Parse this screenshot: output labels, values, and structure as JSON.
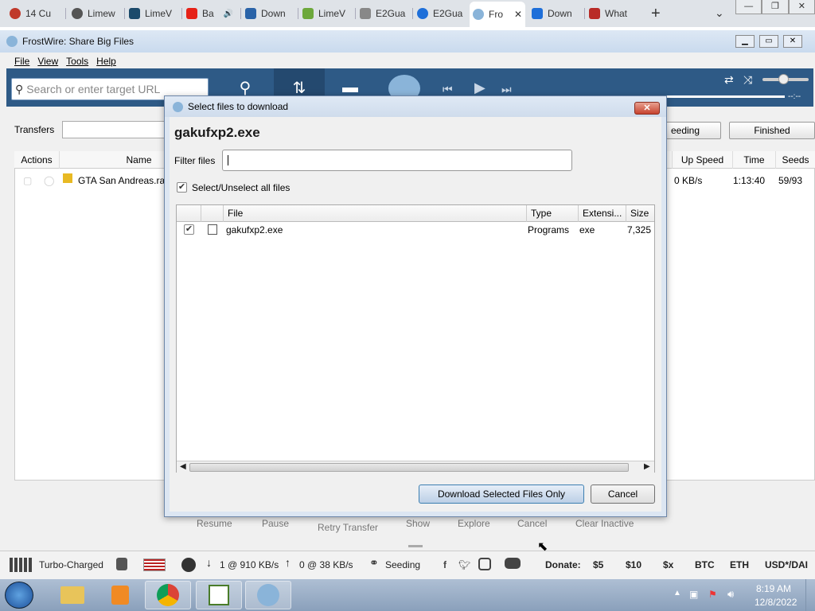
{
  "browser_tabs": [
    {
      "label": "14 Cu",
      "icon": "paw-icon",
      "color": "#c0392b"
    },
    {
      "label": "Limew",
      "icon": "globe-icon",
      "color": "#555555"
    },
    {
      "label": "LimeV",
      "icon": "q-icon",
      "color": "#1b4a6b"
    },
    {
      "label": "Ba",
      "icon": "youtube-icon",
      "color": "#e62117"
    },
    {
      "label": "Down",
      "icon": "windows-icon",
      "color": "#2a63a8"
    },
    {
      "label": "LimeV",
      "icon": "shield-icon",
      "color": "#6da83b"
    },
    {
      "label": "E2Gua",
      "icon": "gear-icon",
      "color": "#888888"
    },
    {
      "label": "E2Gua",
      "icon": "cloud-icon",
      "color": "#1e6fd9"
    },
    {
      "label": "Fro",
      "icon": "frostwire-icon",
      "color": "#8ab4d9",
      "active": true
    },
    {
      "label": "Down",
      "icon": "download-icon",
      "color": "#1e6fd9"
    },
    {
      "label": "What",
      "icon": "quora-icon",
      "color": "#b92b27"
    }
  ],
  "app": {
    "title": "FrostWire: Share Big Files",
    "menu": [
      "File",
      "View",
      "Tools",
      "Help"
    ],
    "search_placeholder": "Search or enter target URL",
    "transfers_label": "Transfers",
    "filter_buttons": {
      "seeding": "eeding",
      "finished": "Finished"
    },
    "columns": {
      "actions": "Actions",
      "name": "Name",
      "up_speed": "Up Speed",
      "time": "Time",
      "seeds": "Seeds"
    },
    "row": {
      "name": "GTA San Andreas.ra",
      "up_speed": "0 KB/s",
      "time": "1:13:40",
      "seeds": "59/93"
    },
    "time_display": "--:--",
    "bottom_buttons": [
      "Resume",
      "Pause",
      "Retry Transfer",
      "Show",
      "Explore",
      "Cancel",
      "Clear Inactive"
    ]
  },
  "status": {
    "turbo": "Turbo-Charged",
    "down": "1 @ 910 KB/s",
    "up": "0 @ 38 KB/s",
    "seeding": "Seeding",
    "donate_label": "Donate:",
    "donate_options": [
      "$5",
      "$10",
      "$x",
      "BTC",
      "ETH",
      "USD*/DAI"
    ]
  },
  "dialog": {
    "title": "Select files to download",
    "heading": "gakufxp2.exe",
    "filter_label": "Filter files",
    "filter_value": "",
    "select_all_label": "Select/Unselect all files",
    "select_all_checked": true,
    "columns": {
      "file": "File",
      "type": "Type",
      "extension": "Extensi...",
      "size": "Size"
    },
    "files": [
      {
        "checked": true,
        "name": "gakufxp2.exe",
        "type": "Programs",
        "extension": "exe",
        "size": "7,325"
      }
    ],
    "download_button": "Download Selected Files Only",
    "cancel_button": "Cancel"
  },
  "clock": {
    "time": "8:19 AM",
    "date": "12/8/2022"
  }
}
